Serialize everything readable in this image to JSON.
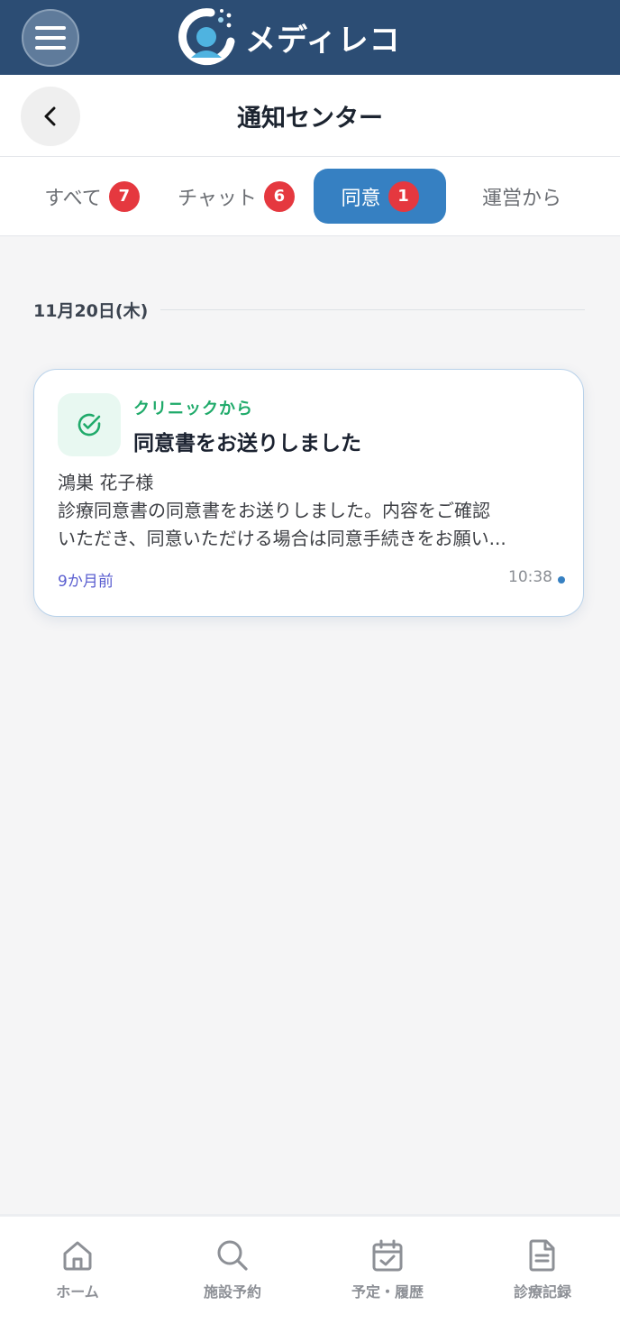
{
  "appbar": {
    "brand_name": "メディレコ"
  },
  "header": {
    "title": "通知センター"
  },
  "tabs": [
    {
      "label": "すべて",
      "count": "7",
      "active": false
    },
    {
      "label": "チャット",
      "count": "6",
      "active": false
    },
    {
      "label": "同意",
      "count": "1",
      "active": true
    },
    {
      "label": "運営から",
      "count": "",
      "active": false
    }
  ],
  "date_group": {
    "label": "11月20日(木)"
  },
  "notification": {
    "source": "クリニックから",
    "title": "同意書をお送りしました",
    "body_lines": [
      "鴻巣 花子様",
      "診療同意書の同意書をお送りしました。内容をご確認",
      "いただき、同意いただける場合は同意手続きをお願い..."
    ],
    "relative_time": "9か月前",
    "time": "10:38",
    "icon": "check-circle-icon"
  },
  "bottom_nav": [
    {
      "label": "ホーム",
      "icon": "home-icon"
    },
    {
      "label": "施設予約",
      "icon": "search-icon"
    },
    {
      "label": "予定・履歴",
      "icon": "calendar-check-icon"
    },
    {
      "label": "診療記録",
      "icon": "document-icon"
    }
  ],
  "colors": {
    "appbar": "#2c4d74",
    "accent": "#3680c2",
    "badge": "#e5383f",
    "source_green": "#1faa6a"
  }
}
